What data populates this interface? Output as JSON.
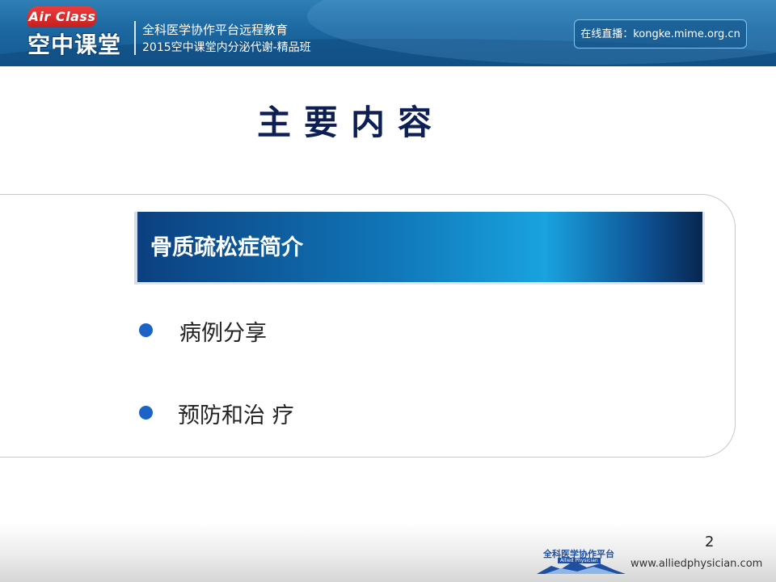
{
  "header": {
    "logo_badge": "Air Class",
    "logo_main": "空中课堂",
    "line1": "全科医学协作平台远程教育",
    "line2": "2015空中课堂内分泌代谢-精品班",
    "live": "在线直播：kongke.mime.org.cn",
    "colors": {
      "banner": "#1c67a1",
      "badge": "#d72b2b"
    }
  },
  "slide": {
    "title": "主要内容",
    "highlight": "骨质疏松症简介",
    "items": [
      {
        "label": "病例分享"
      },
      {
        "label": "预防和治 疗"
      }
    ],
    "colors": {
      "title": "#0d1f55",
      "bullet": "#1b63c6"
    }
  },
  "footer": {
    "page_number": "2",
    "logo_text": "全科医学协作平台",
    "logo_sub": "Allied Physician",
    "url": "www.alliedphysician.com"
  }
}
